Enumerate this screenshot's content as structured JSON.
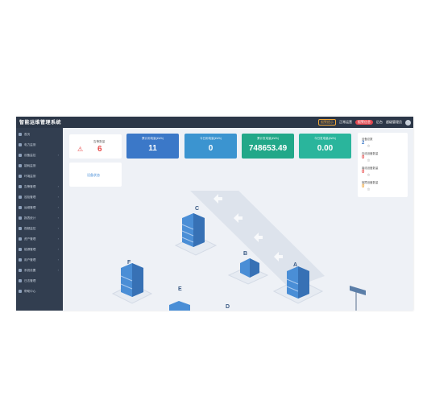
{
  "app": {
    "title": "智能运维管理系统",
    "warning_label": "报警提示",
    "menu_1": "正常运营",
    "badge_label": "报警信息",
    "user_1": "后台",
    "user_2": "超级管理员"
  },
  "sidebar": {
    "items": [
      {
        "label": "首页",
        "icon": "home-icon",
        "arrow": ""
      },
      {
        "label": "电力监测",
        "icon": "monitor-icon",
        "arrow": ""
      },
      {
        "label": "设备监控",
        "icon": "screen-icon",
        "arrow": "›"
      },
      {
        "label": "能耗监测",
        "icon": "chart-icon",
        "arrow": ""
      },
      {
        "label": "环境监测",
        "icon": "leaf-icon",
        "arrow": ""
      },
      {
        "label": "告警管理",
        "icon": "bell-icon",
        "arrow": "›"
      },
      {
        "label": "巡检管理",
        "icon": "check-icon",
        "arrow": "›"
      },
      {
        "label": "运维管理",
        "icon": "tool-icon",
        "arrow": "›"
      },
      {
        "label": "报表统计",
        "icon": "report-icon",
        "arrow": "›"
      },
      {
        "label": "视频监控",
        "icon": "camera-icon",
        "arrow": "›"
      },
      {
        "label": "资产管理",
        "icon": "box-icon",
        "arrow": "›"
      },
      {
        "label": "能源管理",
        "icon": "bolt-icon",
        "arrow": "›"
      },
      {
        "label": "用户管理",
        "icon": "user-icon",
        "arrow": "›"
      },
      {
        "label": "系统设置",
        "icon": "gear-icon",
        "arrow": "›"
      },
      {
        "label": "日志管理",
        "icon": "log-icon",
        "arrow": ""
      },
      {
        "label": "帮助中心",
        "icon": "help-icon",
        "arrow": ""
      }
    ]
  },
  "alarm_card": {
    "icon": "alarm-icon",
    "label": "告警数量",
    "value": "6"
  },
  "small_card": {
    "label": "设备状态"
  },
  "stats": [
    {
      "label": "累计用电量(kWh)",
      "value": "11",
      "color": "#3b78c8"
    },
    {
      "label": "今日用电量(kWh)",
      "value": "0",
      "color": "#3b94d0"
    },
    {
      "label": "累计发电量(kWh)",
      "value": "748653.49",
      "color": "#22a889"
    },
    {
      "label": "今日发电量(kWh)",
      "value": "0.00",
      "color": "#2ab59c"
    }
  ],
  "side_panel": {
    "items": [
      {
        "label": "设备总数",
        "value": "2",
        "unit": "台",
        "color": "#3b78c8"
      },
      {
        "label": "在线设备数量",
        "value": "0",
        "unit": "台",
        "color": "#e84a4a"
      },
      {
        "label": "离线设备数量",
        "value": "0",
        "unit": "台",
        "color": "#e84a4a"
      },
      {
        "label": "故障设备数量",
        "value": "0",
        "unit": "台",
        "color": "#f0a63a"
      }
    ]
  },
  "buildings": {
    "labels": [
      "C",
      "B",
      "A",
      "F",
      "E",
      "D"
    ]
  }
}
